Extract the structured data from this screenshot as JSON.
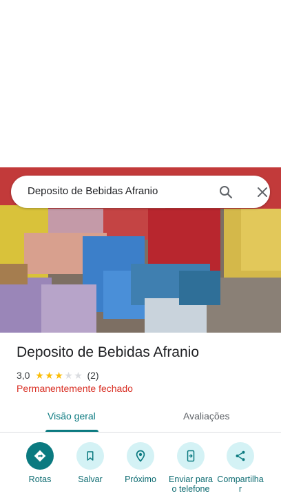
{
  "search": {
    "query": "Deposito de Bebidas Afranio",
    "search_icon": "search-icon",
    "close_icon": "close-icon"
  },
  "place": {
    "name": "Deposito de Bebidas Afranio",
    "rating": "3,0",
    "rating_stars": 3,
    "rating_max": 5,
    "review_count": "(2)",
    "status": "Permanentemente fechado"
  },
  "tabs": [
    {
      "label": "Visão geral",
      "active": true
    },
    {
      "label": "Avaliações",
      "active": false
    }
  ],
  "actions": [
    {
      "label": "Rotas",
      "icon": "directions-icon"
    },
    {
      "label": "Salvar",
      "icon": "bookmark-icon"
    },
    {
      "label": "Próximo",
      "icon": "nearby-icon"
    },
    {
      "label": "Enviar para o telefone",
      "icon": "send-to-phone-icon"
    },
    {
      "label": "Compartilhar",
      "icon": "share-icon"
    }
  ],
  "colors": {
    "accent": "#0b7a80",
    "status_closed": "#d93025",
    "star": "#fbbc04"
  }
}
